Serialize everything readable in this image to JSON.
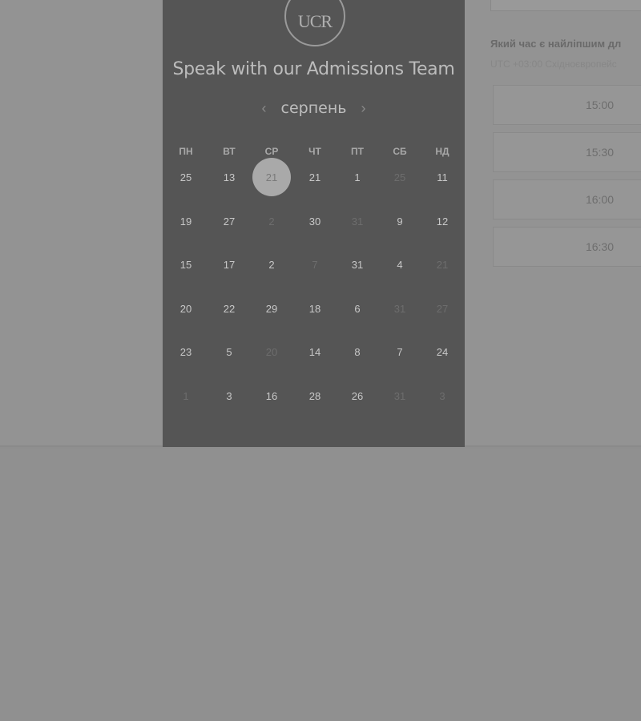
{
  "panel": {
    "logo_text": "UCR",
    "title": "Speak with our Admissions Team",
    "month": "серпень",
    "prev_icon": "chevron-left-icon",
    "next_icon": "chevron-right-icon",
    "weekdays": [
      "ПН",
      "ВТ",
      "СР",
      "ЧТ",
      "ПТ",
      "СБ",
      "НД"
    ],
    "days": [
      [
        "25",
        "13",
        "21",
        "21",
        "1",
        "25",
        "11"
      ],
      [
        "19",
        "27",
        "2",
        "30",
        "31",
        "9",
        "12"
      ],
      [
        "15",
        "17",
        "2",
        "7",
        "31",
        "4",
        "21"
      ],
      [
        "20",
        "22",
        "29",
        "18",
        "6",
        "31",
        "27"
      ],
      [
        "23",
        "5",
        "20",
        "14",
        "8",
        "7",
        "24"
      ],
      [
        "1",
        "3",
        "16",
        "28",
        "26",
        "31",
        "3"
      ]
    ],
    "muted": [
      [
        false,
        false,
        false,
        false,
        false,
        true,
        false
      ],
      [
        false,
        false,
        true,
        false,
        true,
        false,
        false
      ],
      [
        false,
        false,
        false,
        true,
        false,
        false,
        true
      ],
      [
        false,
        false,
        false,
        false,
        false,
        true,
        true
      ],
      [
        false,
        false,
        true,
        false,
        false,
        false,
        false
      ],
      [
        true,
        false,
        false,
        false,
        false,
        true,
        true
      ]
    ],
    "selected": {
      "row": 0,
      "col": 2
    }
  },
  "times": {
    "heading": "Який час є найліпшим дл",
    "timezone": "UTC +03:00 Східноєвропейс",
    "slots": [
      "15:00",
      "15:30",
      "16:00",
      "16:30"
    ]
  },
  "colors": {
    "panel_bg": "#555555",
    "overlay_bg": "#939393",
    "selected_day": "#a9a9a9"
  }
}
